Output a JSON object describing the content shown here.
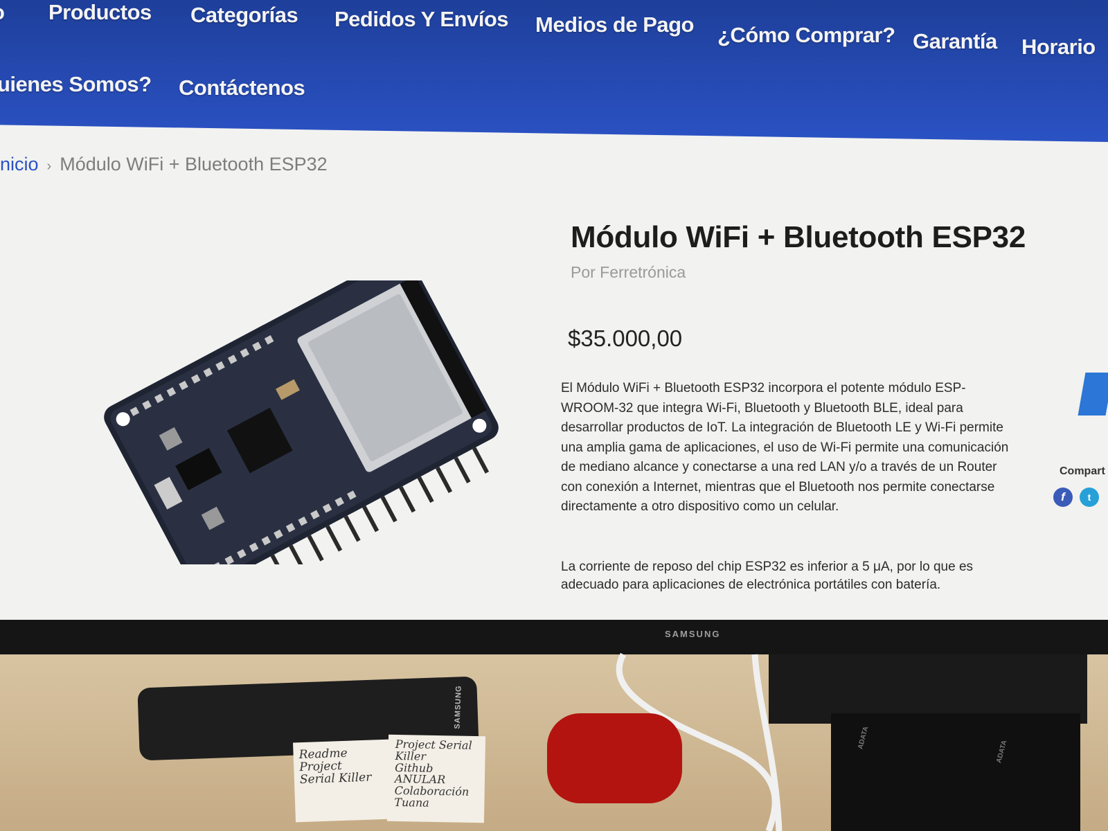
{
  "nav": {
    "row1": [
      "o",
      "Productos",
      "Categorías",
      "Pedidos Y Envíos",
      "Medios de Pago",
      "¿Cómo Comprar?",
      "Garantía",
      "Horario"
    ],
    "row2": [
      "uienes Somos?",
      "Contáctenos"
    ]
  },
  "breadcrumb": {
    "home": "nicio",
    "separator": "›",
    "current": "Módulo WiFi + Bluetooth ESP32"
  },
  "product": {
    "title": "Módulo WiFi + Bluetooth ESP32",
    "vendor": "Por Ferretrónica",
    "price": "$35.000,00",
    "description_1": "El Módulo WiFi + Bluetooth ESP32 incorpora el potente módulo ESP-WROOM-32 que integra Wi-Fi, Bluetooth y Bluetooth BLE, ideal para desarrollar productos de IoT.  La integración de Bluetooth LE y Wi-Fi permite una amplia gama de aplicaciones, el uso de Wi-Fi permite una comunicación de mediano alcance y conectarse a una red LAN y/o a través de un Router con conexión a Internet, mientras que el Bluetooth nos permite conectarse directamente a otro dispositivo como un celular.",
    "description_2": "La corriente de reposo del chip ESP32 es inferior a 5 μA, por lo que es adecuado para aplicaciones de electrónica portátiles con batería."
  },
  "share": {
    "label": "Compart",
    "icons": [
      "facebook-icon",
      "twitter-icon"
    ],
    "facebook_glyph": "f",
    "twitter_glyph": "t"
  },
  "monitor": {
    "brand": "SAMSUNG"
  },
  "desk": {
    "remote_brand": "SAMSUNG",
    "hdd_brand": "ADATA",
    "note_1": [
      "Readme",
      "Project",
      "Serial Killer"
    ],
    "note_2": [
      "Project Serial",
      "Killer",
      "Github",
      "ANULAR",
      "Colaboración",
      "Tuana"
    ]
  },
  "colors": {
    "nav_bg": "#2b52c4",
    "link": "#2b52c4",
    "page_bg": "#f2f2f0",
    "case_red": "#b3140f"
  }
}
